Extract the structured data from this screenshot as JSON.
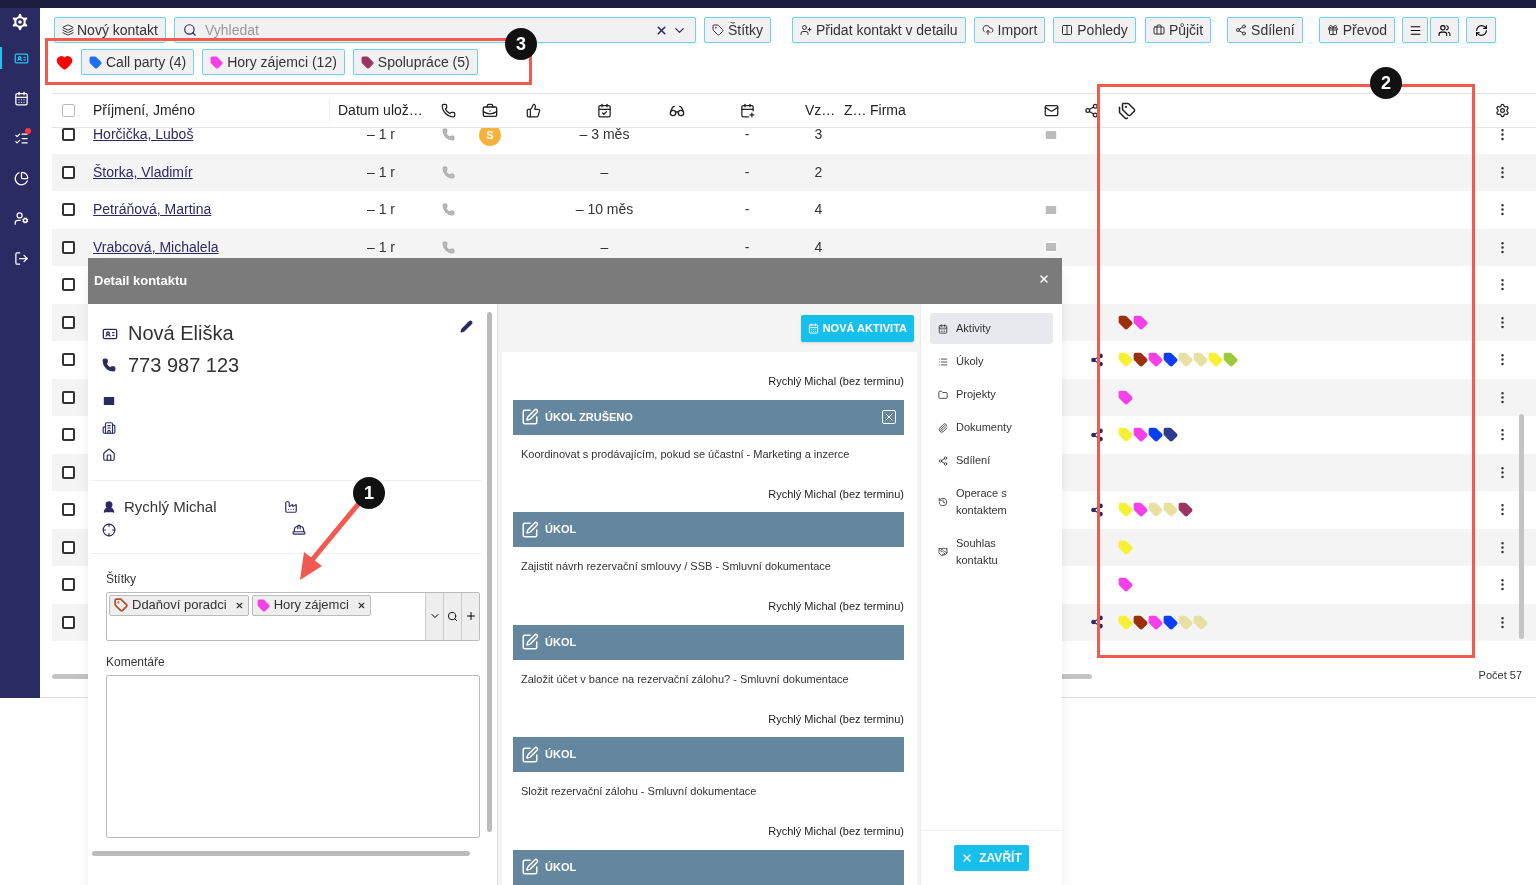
{
  "sidebar": {
    "items": [
      {
        "selected": true,
        "alert": false
      },
      {
        "selected": false,
        "alert": false
      },
      {
        "selected": false,
        "alert": true
      },
      {
        "selected": false,
        "alert": false
      },
      {
        "selected": false,
        "alert": false
      },
      {
        "selected": false,
        "alert": false
      }
    ]
  },
  "toolbar": {
    "new_contact": "Nový kontakt",
    "search": {
      "placeholder": "Vyhledat"
    },
    "buttons": [
      "Štítky",
      "Přidat kontakt v detailu",
      "Import",
      "Pohledy",
      "Půjčit",
      "Sdílení",
      "Převod"
    ]
  },
  "favorites": {
    "chips": [
      {
        "label": "Call party (4)",
        "color": "#1e6ff0"
      },
      {
        "label": "Hory zájemci (12)",
        "color": "#f53fe8"
      },
      {
        "label": "Spolupráce (5)",
        "color": "#9c3460"
      }
    ]
  },
  "table": {
    "select_all": {
      "checked": false
    },
    "headers": {
      "name": "Příjmení, Jméno",
      "saved": "Datum ulož…",
      "vz": "Vz…",
      "z": "Z…",
      "company": "Firma"
    },
    "rows": [
      {
        "checked": false,
        "name": "Horčička, Luboš",
        "saved": "– 1 r",
        "phone": true,
        "badge": "S",
        "activity": "– 3 měs",
        "event": "-",
        "vz": "3",
        "mail": true,
        "shared": false,
        "tags": []
      },
      {
        "checked": false,
        "name": "Štorka, Vladimír",
        "saved": "– 1 r",
        "phone": true,
        "activity": "–",
        "event": "-",
        "vz": "2",
        "mail": false,
        "shared": false,
        "tags": []
      },
      {
        "checked": false,
        "name": "Petráňová, Martina",
        "saved": "– 1 r",
        "phone": true,
        "activity": "– 10 měs",
        "event": "-",
        "vz": "4",
        "mail": true,
        "shared": false,
        "tags": []
      },
      {
        "checked": false,
        "name": "Vrabcová, Michalela",
        "saved": "– 1 r",
        "phone": true,
        "activity": "–",
        "event": "-",
        "vz": "4",
        "mail": true,
        "shared": false,
        "tags": []
      },
      {
        "checked": false,
        "shared": false,
        "tags": []
      },
      {
        "checked": false,
        "shared": false,
        "tags": [
          {
            "color": "#9c2f0c"
          },
          {
            "color": "#f53fe8"
          }
        ]
      },
      {
        "checked": false,
        "shared": true,
        "tags": [
          {
            "color": "#f7f034"
          },
          {
            "color": "#9c2f0c"
          },
          {
            "color": "#f53fe8"
          },
          {
            "color": "#0b3ef5"
          },
          {
            "color": "#e8e0a0"
          },
          {
            "color": "#e8e0a0"
          },
          {
            "color": "#f7f034"
          },
          {
            "color": "#9ccb3a"
          }
        ]
      },
      {
        "checked": false,
        "shared": false,
        "tags": [
          {
            "color": "#f53fe8"
          }
        ]
      },
      {
        "checked": false,
        "shared": true,
        "tags": [
          {
            "color": "#f7f034"
          },
          {
            "color": "#f53fe8"
          },
          {
            "color": "#0b3ef5"
          },
          {
            "color": "#2e3a8c"
          }
        ]
      },
      {
        "checked": false,
        "shared": false,
        "tags": []
      },
      {
        "checked": false,
        "shared": true,
        "tags": [
          {
            "color": "#f7f034"
          },
          {
            "color": "#f53fe8"
          },
          {
            "color": "#e8e0a0"
          },
          {
            "color": "#e8e0a0"
          },
          {
            "color": "#9c3460"
          }
        ]
      },
      {
        "checked": false,
        "shared": false,
        "tags": [
          {
            "color": "#f7f034"
          }
        ]
      },
      {
        "checked": false,
        "shared": false,
        "tags": [
          {
            "color": "#f53fe8"
          }
        ]
      },
      {
        "checked": false,
        "shared": true,
        "tags": [
          {
            "color": "#f7f034"
          },
          {
            "color": "#9c2f0c"
          },
          {
            "color": "#f53fe8"
          },
          {
            "color": "#0b3ef5"
          },
          {
            "color": "#e8e0a0"
          },
          {
            "color": "#e8e0a0"
          }
        ]
      }
    ],
    "count": "Počet 57"
  },
  "modal": {
    "title": "Detail kontaktu",
    "contact": {
      "name": "Nová Eliška",
      "phone": "773 987 123",
      "owner": "Rychlý Michal"
    },
    "tags_label": "Štítky",
    "tags": [
      {
        "label": "Ddaňoví poradci",
        "kind": "outline",
        "color": "#b5532a"
      },
      {
        "label": "Hory zájemci",
        "kind": "filled",
        "color": "#f53fe8"
      }
    ],
    "comments_label": "Komentáře",
    "new_activity": "NOVÁ AKTIVITA",
    "activities": [
      {
        "meta": "Rychlý Michal (bez terminu)",
        "title": "ÚKOL ZRUŠENO",
        "cancelled": true,
        "text": "Koordinovat s prodávajícím, pokud se účastní - Marketing a inzerce"
      },
      {
        "meta": "Rychlý Michal (bez terminu)",
        "title": "ÚKOL",
        "cancelled": false,
        "text": "Zajistit návrh rezervační smlouvy / SSB - Smluvní dokumentace"
      },
      {
        "meta": "Rychlý Michal (bez terminu)",
        "title": "ÚKOL",
        "cancelled": false,
        "text": "Založit účet v bance na rezervační zálohu? - Smluvní dokumentace"
      },
      {
        "meta": "Rychlý Michal (bez terminu)",
        "title": "ÚKOL",
        "cancelled": false,
        "text": "Složit rezervační zálohu - Smluvní dokumentace"
      },
      {
        "meta": "Rychlý Michal (bez terminu)",
        "title": "ÚKOL",
        "cancelled": false
      }
    ],
    "nav": [
      {
        "label": "Aktivity",
        "selected": true
      },
      {
        "label": "Úkoly",
        "selected": false
      },
      {
        "label": "Projekty",
        "selected": false
      },
      {
        "label": "Dokumenty",
        "selected": false
      },
      {
        "label": "Sdílení",
        "selected": false
      },
      {
        "label": "Operace s kontaktem",
        "selected": false
      },
      {
        "label": "Souhlas kontaktu",
        "selected": false
      }
    ],
    "close": "ZAVŘÍT"
  },
  "annotations": [
    {
      "label": "1"
    },
    {
      "label": "2"
    },
    {
      "label": "3"
    }
  ]
}
